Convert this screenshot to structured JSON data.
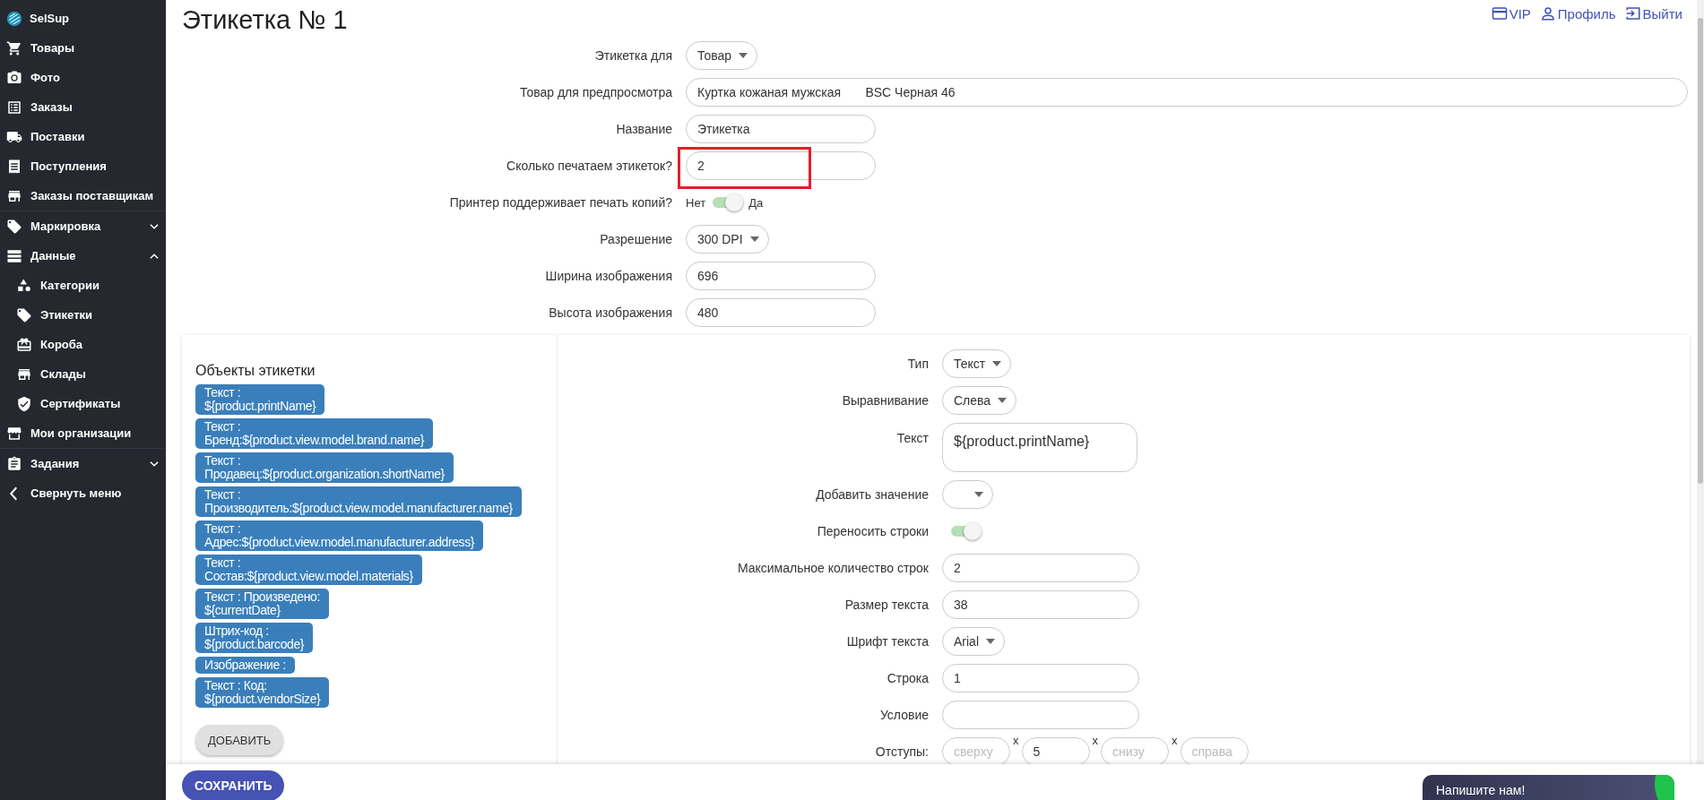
{
  "sidebar": {
    "brand": "SelSup",
    "sections": [
      {
        "items": [
          {
            "label": "Товары",
            "kind": "link"
          },
          {
            "label": "Фото",
            "kind": "link"
          },
          {
            "label": "Заказы",
            "kind": "link"
          },
          {
            "label": "Поставки",
            "kind": "link"
          },
          {
            "label": "Поступления",
            "kind": "link"
          },
          {
            "label": "Заказы поставщикам",
            "kind": "link"
          }
        ]
      },
      {
        "items": [
          {
            "label": "Маркировка",
            "kind": "group",
            "expanded": false
          },
          {
            "label": "Данные",
            "kind": "group",
            "expanded": true,
            "children": [
              {
                "label": "Категории",
                "kind": "link"
              },
              {
                "label": "Этикетки",
                "kind": "link"
              },
              {
                "label": "Короба",
                "kind": "link"
              },
              {
                "label": "Склады",
                "kind": "link"
              },
              {
                "label": "Сертификаты",
                "kind": "link"
              }
            ]
          },
          {
            "label": "Мои организации",
            "kind": "link"
          }
        ]
      },
      {
        "items": [
          {
            "label": "Задания",
            "kind": "group",
            "expanded": false
          },
          {
            "label": "Свернуть меню",
            "kind": "action"
          }
        ]
      }
    ]
  },
  "header": {
    "title": "Этикетка № 1",
    "links": [
      {
        "label": "VIP"
      },
      {
        "label": "Профиль"
      },
      {
        "label": "Выйти"
      }
    ]
  },
  "label_form": {
    "rows": [
      {
        "label": "Этикетка для",
        "kind": "select",
        "value": "Товар"
      },
      {
        "label": "Товар для предпросмотра",
        "kind": "wide_input",
        "value": "Куртка кожаная мужская       BSC Черная 46"
      },
      {
        "label": "Название",
        "kind": "input",
        "value": "Этикетка"
      },
      {
        "label": "Сколько печатаем этикеток?",
        "kind": "input",
        "value": "2",
        "highlighted": true
      },
      {
        "label": "Принтер поддерживает печать копий?",
        "kind": "toggle",
        "off_label": "Нет",
        "on_label": "Да",
        "on": true
      },
      {
        "label": "Разрешение",
        "kind": "select",
        "value": "300 DPI"
      },
      {
        "label": "Ширина изображения",
        "kind": "input",
        "value": "696"
      },
      {
        "label": "Высота изображения",
        "kind": "input",
        "value": "480"
      }
    ]
  },
  "objects_panel": {
    "title": "Объекты этикетки",
    "items": [
      {
        "text": "Текст :\n${product.printName}"
      },
      {
        "text": "Текст :\nБренд:${product.view.model.brand.name}"
      },
      {
        "text": "Текст :\nПродавец:${product.organization.shortName}"
      },
      {
        "text": "Текст :\nПроизводитель:${product.view.model.manufacturer.name}"
      },
      {
        "text": "Текст :\nАдрес:${product.view.model.manufacturer.address}"
      },
      {
        "text": "Текст :\nСостав:${product.view.model.materials}"
      },
      {
        "text": "Текст : Произведено:\n${currentDate}"
      },
      {
        "text": "Штрих-код :\n${product.barcode}"
      },
      {
        "text": "Изображение :"
      },
      {
        "text": "Текст : Код:\n${product.vendorSize}"
      }
    ],
    "add_button": "ДОБАВИТЬ"
  },
  "object_editor": {
    "rows": [
      {
        "label": "Тип",
        "kind": "select",
        "value": "Текст"
      },
      {
        "label": "Выравнивание",
        "kind": "select",
        "value": "Слева"
      },
      {
        "label": "Текст",
        "kind": "textarea",
        "value": "${product.printName}"
      },
      {
        "label": "Добавить значение",
        "kind": "select"
      },
      {
        "label": "Переносить строки",
        "kind": "toggle",
        "on": true
      },
      {
        "label": "Максимальное количество строк",
        "kind": "input",
        "value": "2"
      },
      {
        "label": "Размер текста",
        "kind": "input",
        "value": "38"
      },
      {
        "label": "Шрифт текста",
        "kind": "select",
        "value": "Arial"
      },
      {
        "label": "Строка",
        "kind": "input",
        "value": "1"
      },
      {
        "label": "Условие",
        "kind": "input"
      },
      {
        "label": "Отступы:",
        "kind": "margins",
        "fields": [
          {
            "placeholder": "сверху",
            "suffix": "x"
          },
          {
            "value": "5",
            "suffix": "x"
          },
          {
            "placeholder": "снизу",
            "suffix": "x"
          },
          {
            "placeholder": "справа"
          }
        ]
      }
    ]
  },
  "footer": {
    "save_button": "СОХРАНИТЬ"
  },
  "chat_widget": {
    "label": "Напишите нам!"
  }
}
